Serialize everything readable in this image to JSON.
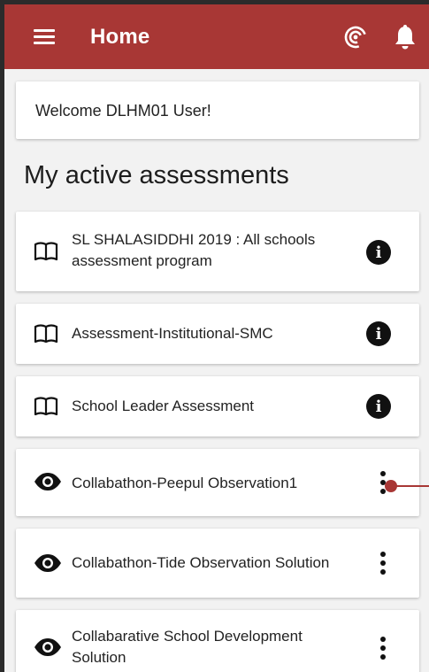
{
  "appbar": {
    "title": "Home"
  },
  "welcome": {
    "text": "Welcome DLHM01 User!"
  },
  "section": {
    "title": "My active assessments"
  },
  "items": [
    {
      "label": "SL SHALASIDDHI 2019 : All schools assessment program",
      "icon": "book-icon",
      "action": "info-icon"
    },
    {
      "label": "Assessment-Institutional-SMC",
      "icon": "book-icon",
      "action": "info-icon"
    },
    {
      "label": "School Leader Assessment",
      "icon": "book-icon",
      "action": "info-icon"
    },
    {
      "label": "Collabathon-Peepul Observation1",
      "icon": "eye-icon",
      "action": "more-vert-icon"
    },
    {
      "label": "Collabathon-Tide Observation Solution",
      "icon": "eye-icon",
      "action": "more-vert-icon"
    },
    {
      "label": "Collabarative School Development Solution",
      "icon": "eye-icon",
      "action": "more-vert-icon"
    }
  ],
  "colors": {
    "appbar": "#a83735",
    "background": "#f2f2f2",
    "card": "#ffffff",
    "text": "#222222"
  }
}
